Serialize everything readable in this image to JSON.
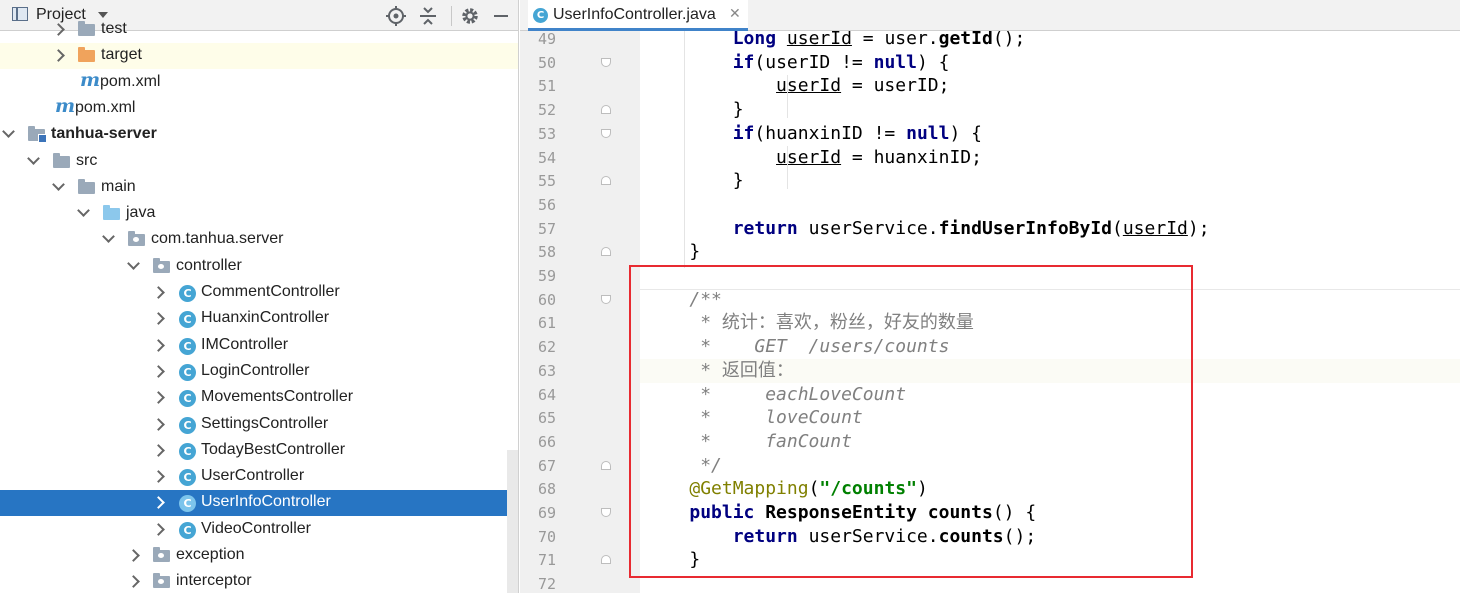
{
  "project_panel": {
    "title": "Project",
    "tree": [
      {
        "label": "test",
        "depth": 4,
        "type": "folder",
        "chevron": "right",
        "partial": true
      },
      {
        "label": "target",
        "depth": 4,
        "type": "folder-orange",
        "chevron": "right",
        "highlight": true
      },
      {
        "label": "pom.xml",
        "depth": 4,
        "type": "maven",
        "chevron": ""
      },
      {
        "label": "pom.xml",
        "depth": 3,
        "type": "maven",
        "chevron": ""
      },
      {
        "label": "tanhua-server",
        "depth": 2,
        "type": "module",
        "chevron": "down",
        "bold": true
      },
      {
        "label": "src",
        "depth": 3,
        "type": "folder",
        "chevron": "down"
      },
      {
        "label": "main",
        "depth": 4,
        "type": "folder",
        "chevron": "down"
      },
      {
        "label": "java",
        "depth": 5,
        "type": "folder-blue",
        "chevron": "down"
      },
      {
        "label": "com.tanhua.server",
        "depth": 6,
        "type": "package",
        "chevron": "down"
      },
      {
        "label": "controller",
        "depth": 7,
        "type": "package",
        "chevron": "down"
      },
      {
        "label": "CommentController",
        "depth": 8,
        "type": "class",
        "chevron": "right"
      },
      {
        "label": "HuanxinController",
        "depth": 8,
        "type": "class",
        "chevron": "right"
      },
      {
        "label": "IMController",
        "depth": 8,
        "type": "class",
        "chevron": "right"
      },
      {
        "label": "LoginController",
        "depth": 8,
        "type": "class",
        "chevron": "right"
      },
      {
        "label": "MovementsController",
        "depth": 8,
        "type": "class",
        "chevron": "right"
      },
      {
        "label": "SettingsController",
        "depth": 8,
        "type": "class",
        "chevron": "right"
      },
      {
        "label": "TodayBestController",
        "depth": 8,
        "type": "class",
        "chevron": "right"
      },
      {
        "label": "UserController",
        "depth": 8,
        "type": "class",
        "chevron": "right"
      },
      {
        "label": "UserInfoController",
        "depth": 8,
        "type": "class",
        "chevron": "right",
        "selected": true
      },
      {
        "label": "VideoController",
        "depth": 8,
        "type": "class",
        "chevron": "right"
      },
      {
        "label": "exception",
        "depth": 7,
        "type": "package",
        "chevron": "right"
      },
      {
        "label": "interceptor",
        "depth": 7,
        "type": "package",
        "chevron": "right"
      }
    ]
  },
  "editor": {
    "tab_label": "UserInfoController.java",
    "tab_icon": "C",
    "class_icon": "C",
    "caret_line": 63,
    "lines": [
      {
        "n": 49,
        "fold": "",
        "tokens": [
          [
            "ind",
            "        "
          ],
          [
            "kw",
            "Long "
          ],
          [
            "var",
            "userId"
          ],
          [
            "plain",
            " = "
          ],
          [
            "plain",
            "user."
          ],
          [
            "meth",
            "getId"
          ],
          [
            "par",
            "();"
          ]
        ]
      },
      {
        "n": 50,
        "fold": "down",
        "tokens": [
          [
            "ind",
            "        "
          ],
          [
            "kw",
            "if"
          ],
          [
            "plain",
            "(userID != "
          ],
          [
            "kw",
            "null"
          ],
          [
            "plain",
            ") {"
          ]
        ]
      },
      {
        "n": 51,
        "fold": "",
        "tokens": [
          [
            "ind",
            "            "
          ],
          [
            "var",
            "userId"
          ],
          [
            "plain",
            " = userID;"
          ]
        ]
      },
      {
        "n": 52,
        "fold": "up",
        "tokens": [
          [
            "ind",
            "        "
          ],
          [
            "plain",
            "}"
          ]
        ]
      },
      {
        "n": 53,
        "fold": "down",
        "tokens": [
          [
            "ind",
            "        "
          ],
          [
            "kw",
            "if"
          ],
          [
            "plain",
            "(huanxinID != "
          ],
          [
            "kw",
            "null"
          ],
          [
            "plain",
            ") {"
          ]
        ]
      },
      {
        "n": 54,
        "fold": "",
        "tokens": [
          [
            "ind",
            "            "
          ],
          [
            "var",
            "userId"
          ],
          [
            "plain",
            " = huanxinID;"
          ]
        ]
      },
      {
        "n": 55,
        "fold": "up",
        "tokens": [
          [
            "ind",
            "        "
          ],
          [
            "plain",
            "}"
          ]
        ]
      },
      {
        "n": 56,
        "fold": "",
        "tokens": []
      },
      {
        "n": 57,
        "fold": "",
        "tokens": [
          [
            "ind",
            "        "
          ],
          [
            "kw",
            "return "
          ],
          [
            "plain",
            "userService."
          ],
          [
            "meth",
            "findUserInfoById"
          ],
          [
            "plain",
            "("
          ],
          [
            "var",
            "userId"
          ],
          [
            "plain",
            ");"
          ]
        ]
      },
      {
        "n": 58,
        "fold": "up",
        "tokens": [
          [
            "ind",
            "    "
          ],
          [
            "plain",
            "}"
          ]
        ]
      },
      {
        "n": 59,
        "fold": "",
        "tokens": []
      },
      {
        "n": 60,
        "fold": "down",
        "tokens": [
          [
            "ind",
            "    "
          ],
          [
            "com",
            "/**"
          ]
        ]
      },
      {
        "n": 61,
        "fold": "",
        "tokens": [
          [
            "ind",
            "     "
          ],
          [
            "com",
            "* "
          ],
          [
            "cjk",
            "统计：喜欢，粉丝，好友的数量"
          ]
        ]
      },
      {
        "n": 62,
        "fold": "",
        "tokens": [
          [
            "ind",
            "     "
          ],
          [
            "com",
            "*    GET  /users/counts"
          ]
        ]
      },
      {
        "n": 63,
        "fold": "",
        "tokens": [
          [
            "ind",
            "     "
          ],
          [
            "com",
            "* "
          ],
          [
            "cjk",
            "返回值："
          ]
        ]
      },
      {
        "n": 64,
        "fold": "",
        "tokens": [
          [
            "ind",
            "     "
          ],
          [
            "com",
            "*     eachLoveCount"
          ]
        ]
      },
      {
        "n": 65,
        "fold": "",
        "tokens": [
          [
            "ind",
            "     "
          ],
          [
            "com",
            "*     loveCount"
          ]
        ]
      },
      {
        "n": 66,
        "fold": "",
        "tokens": [
          [
            "ind",
            "     "
          ],
          [
            "com",
            "*     fanCount"
          ]
        ]
      },
      {
        "n": 67,
        "fold": "up",
        "tokens": [
          [
            "ind",
            "     "
          ],
          [
            "com",
            "*/"
          ]
        ]
      },
      {
        "n": 68,
        "fold": "",
        "tokens": [
          [
            "ind",
            "    "
          ],
          [
            "ann",
            "@GetMapping"
          ],
          [
            "plain",
            "("
          ],
          [
            "str",
            "\"/counts\""
          ],
          [
            "plain",
            ")"
          ]
        ]
      },
      {
        "n": 69,
        "fold": "down",
        "tokens": [
          [
            "ind",
            "    "
          ],
          [
            "kw",
            "public "
          ],
          [
            "meth",
            "ResponseEntity "
          ],
          [
            "meth",
            "counts"
          ],
          [
            "plain",
            "() {"
          ]
        ]
      },
      {
        "n": 70,
        "fold": "",
        "tokens": [
          [
            "ind",
            "        "
          ],
          [
            "kw",
            "return "
          ],
          [
            "plain",
            "userService."
          ],
          [
            "meth",
            "counts"
          ],
          [
            "plain",
            "();"
          ]
        ]
      },
      {
        "n": 71,
        "fold": "up",
        "tokens": [
          [
            "ind",
            "    "
          ],
          [
            "plain",
            "}"
          ]
        ]
      },
      {
        "n": 72,
        "fold": "",
        "tokens": []
      }
    ]
  },
  "colors": {
    "selection": "#2775c3",
    "highlight_box": "#e82a31",
    "keyword": "#000080",
    "string": "#008000",
    "annotation": "#808000",
    "comment": "#808080"
  }
}
